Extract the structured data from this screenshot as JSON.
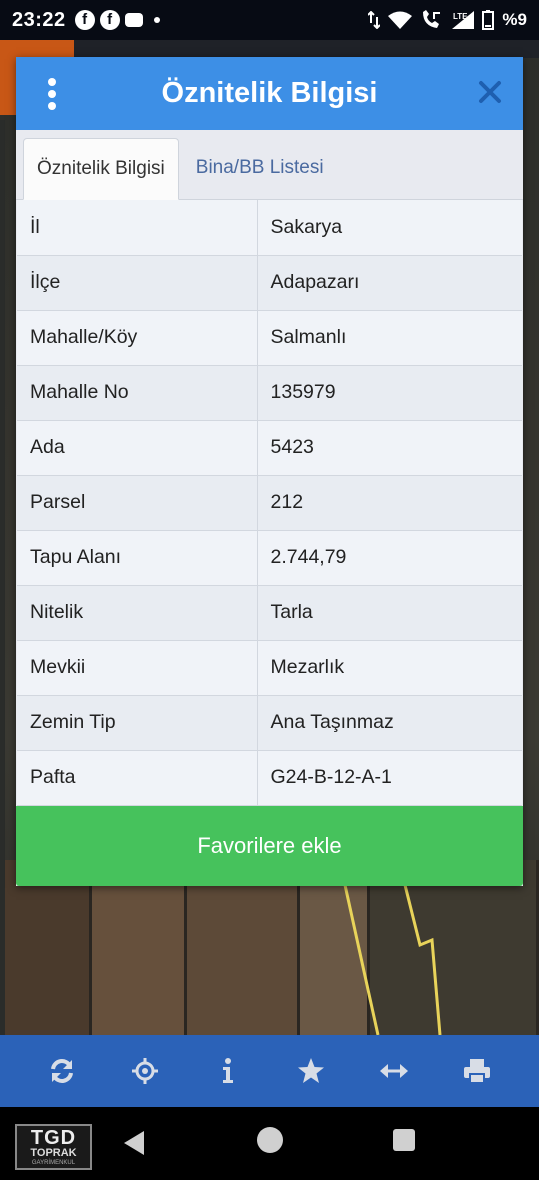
{
  "status_bar": {
    "time": "23:22",
    "battery": "%9",
    "notification_icons": [
      "facebook-icon",
      "facebook-icon",
      "message-icon",
      "dot-icon"
    ],
    "system_icons": [
      "data-arrows-icon",
      "wifi-icon",
      "wifi-call-icon",
      "lte-signal-icon",
      "battery-icon"
    ]
  },
  "dialog": {
    "title": "Öznitelik Bilgisi",
    "tabs": [
      {
        "label": "Öznitelik Bilgisi",
        "active": true
      },
      {
        "label": "Bina/BB Listesi",
        "active": false
      }
    ],
    "rows": [
      {
        "label": "İl",
        "value": "Sakarya"
      },
      {
        "label": "İlçe",
        "value": "Adapazarı"
      },
      {
        "label": "Mahalle/Köy",
        "value": "Salmanlı"
      },
      {
        "label": "Mahalle No",
        "value": "135979"
      },
      {
        "label": "Ada",
        "value": "5423"
      },
      {
        "label": "Parsel",
        "value": "212"
      },
      {
        "label": "Tapu Alanı",
        "value": "2.744,79"
      },
      {
        "label": "Nitelik",
        "value": "Tarla"
      },
      {
        "label": "Mevkii",
        "value": "Mezarlık"
      },
      {
        "label": "Zemin Tip",
        "value": "Ana Taşınmaz"
      },
      {
        "label": "Pafta",
        "value": "G24-B-12-A-1"
      }
    ],
    "favorite_button": "Favorilere ekle"
  },
  "toolbar": {
    "icons": [
      "refresh-icon",
      "locate-icon",
      "info-icon",
      "star-icon",
      "measure-icon",
      "print-icon"
    ]
  },
  "navbar": {
    "logo_text": "TGD",
    "logo_sub": "TOPRAK",
    "logo_tiny": "GAYRİMENKUL"
  },
  "colors": {
    "header_blue": "#3d8fe6",
    "button_green": "#46c25c",
    "toolbar_blue": "#2b62b8",
    "map_orange": "#c85716"
  }
}
